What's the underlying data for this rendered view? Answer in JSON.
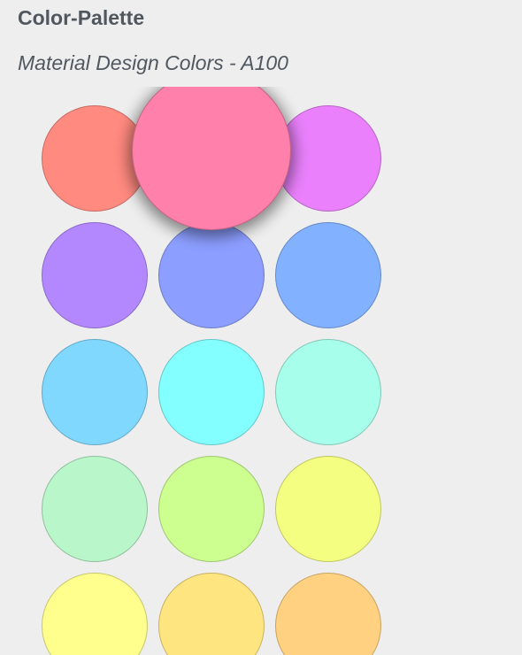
{
  "header": {
    "title": "Color-Palette",
    "subtitle": "Material Design Colors - A100"
  },
  "palette": {
    "selected_color": "#ff80ab",
    "swatches": [
      {
        "name": "red-a100",
        "color": "#ff8a80"
      },
      {
        "name": "pink-a100",
        "color": "#ff80ab",
        "selected": true
      },
      {
        "name": "purple-a100",
        "color": "#ea80fc"
      },
      {
        "name": "deep-purple-a100",
        "color": "#b388ff"
      },
      {
        "name": "indigo-a100",
        "color": "#8c9eff"
      },
      {
        "name": "blue-a100",
        "color": "#82b1ff"
      },
      {
        "name": "light-blue-a100",
        "color": "#80d8ff"
      },
      {
        "name": "cyan-a100",
        "color": "#84ffff"
      },
      {
        "name": "teal-a100",
        "color": "#a7ffeb"
      },
      {
        "name": "green-a100",
        "color": "#b9f6ca"
      },
      {
        "name": "light-green-a100",
        "color": "#ccff90"
      },
      {
        "name": "lime-a100",
        "color": "#f4ff81"
      },
      {
        "name": "yellow-a100",
        "color": "#ffff8d"
      },
      {
        "name": "amber-a100",
        "color": "#ffe57f"
      },
      {
        "name": "orange-a100",
        "color": "#ffd180"
      }
    ]
  }
}
